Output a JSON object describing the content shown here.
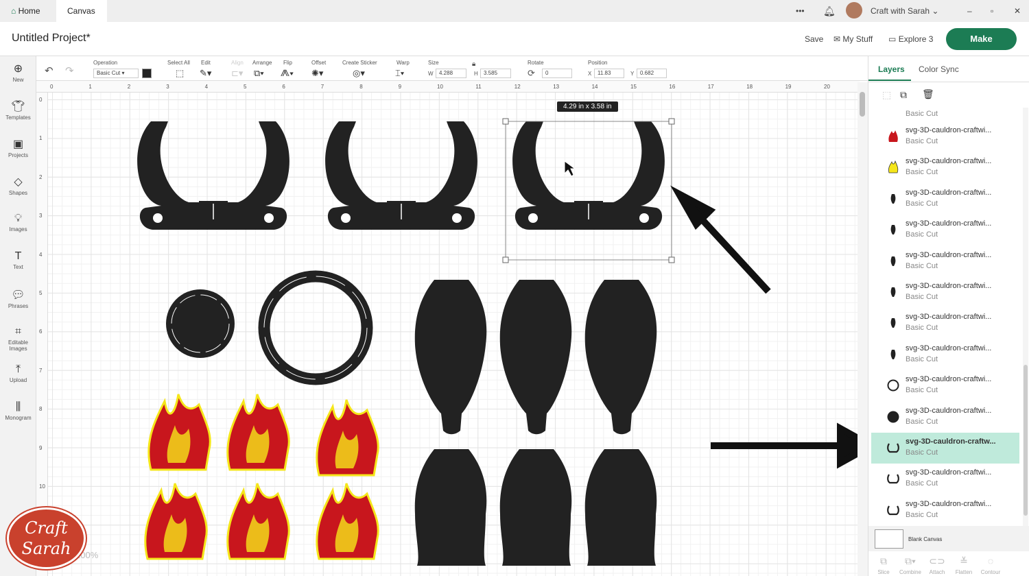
{
  "tabs": {
    "home": "Home",
    "canvas": "Canvas"
  },
  "topbar": {
    "more": "•••",
    "user": "Craft with Sarah"
  },
  "header": {
    "title": "Untitled Project*",
    "save": "Save",
    "my_stuff": "My Stuff",
    "machine": "Explore 3",
    "make": "Make"
  },
  "sidebar": [
    {
      "icon": "plus-icon",
      "label": "New"
    },
    {
      "icon": "shirt-icon",
      "label": "Templates"
    },
    {
      "icon": "projects-icon",
      "label": "Projects"
    },
    {
      "icon": "shapes-icon",
      "label": "Shapes"
    },
    {
      "icon": "bulb-icon",
      "label": "Images"
    },
    {
      "icon": "text-icon",
      "label": "Text"
    },
    {
      "icon": "chat-icon",
      "label": "Phrases"
    },
    {
      "icon": "editable-images-icon",
      "label": "Editable Images"
    },
    {
      "icon": "upload-icon",
      "label": "Upload"
    },
    {
      "icon": "monogram-icon",
      "label": "Monogram"
    }
  ],
  "toolbar": {
    "operation_label": "Operation",
    "operation_value": "Basic Cut",
    "select_all": "Select All",
    "edit": "Edit",
    "align": "Align",
    "arrange": "Arrange",
    "flip": "Flip",
    "offset": "Offset",
    "create_sticker": "Create Sticker",
    "warp": "Warp",
    "size": "Size",
    "w_label": "W",
    "w": "4.288",
    "h_label": "H",
    "h": "3.585",
    "rotate": "Rotate",
    "rotate_value": "0",
    "position": "Position",
    "x_label": "X",
    "x": "11.83",
    "y_label": "Y",
    "y": "0.682",
    "color": "#222222"
  },
  "ruler_h": [
    "0",
    "1",
    "2",
    "3",
    "4",
    "5",
    "6",
    "7",
    "8",
    "9",
    "10",
    "11",
    "12",
    "13",
    "14",
    "15",
    "16",
    "17",
    "18",
    "19",
    "20"
  ],
  "ruler_v": [
    "0",
    "1",
    "2",
    "3",
    "4",
    "5",
    "6",
    "7",
    "8",
    "9",
    "10"
  ],
  "selection_size": "4.29  in x 3.58  in",
  "zoom": "100%",
  "logo_text": "Craft with Sarah",
  "panel": {
    "tabs": [
      "Layers",
      "Color Sync"
    ],
    "layers": [
      {
        "name": "svg-3D-cauldron-craftwi...",
        "op": "Basic Cut",
        "thumb": "red-flame"
      },
      {
        "name": "svg-3D-cauldron-craftwi...",
        "op": "Basic Cut",
        "thumb": "yellow-flame"
      },
      {
        "name": "svg-3D-cauldron-craftwi...",
        "op": "Basic Cut",
        "thumb": "drop"
      },
      {
        "name": "svg-3D-cauldron-craftwi...",
        "op": "Basic Cut",
        "thumb": "drop"
      },
      {
        "name": "svg-3D-cauldron-craftwi...",
        "op": "Basic Cut",
        "thumb": "drop"
      },
      {
        "name": "svg-3D-cauldron-craftwi...",
        "op": "Basic Cut",
        "thumb": "drop"
      },
      {
        "name": "svg-3D-cauldron-craftwi...",
        "op": "Basic Cut",
        "thumb": "drop"
      },
      {
        "name": "svg-3D-cauldron-craftwi...",
        "op": "Basic Cut",
        "thumb": "drop"
      },
      {
        "name": "svg-3D-cauldron-craftwi...",
        "op": "Basic Cut",
        "thumb": "ring"
      },
      {
        "name": "svg-3D-cauldron-craftwi...",
        "op": "Basic Cut",
        "thumb": "circle"
      },
      {
        "name": "svg-3D-cauldron-craftw...",
        "op": "Basic Cut",
        "thumb": "cauldron",
        "selected": true
      },
      {
        "name": "svg-3D-cauldron-craftwi...",
        "op": "Basic Cut",
        "thumb": "cauldron"
      },
      {
        "name": "svg-3D-cauldron-craftwi...",
        "op": "Basic Cut",
        "thumb": "cauldron"
      }
    ],
    "partial_top": "Basic Cut",
    "blank_canvas": "Blank Canvas",
    "tools": [
      "Slice",
      "Combine",
      "Attach",
      "Flatten",
      "Contour"
    ]
  },
  "colors": {
    "accent": "#1c7c54",
    "selected": "#bfeadb",
    "flame_red": "#c8161d",
    "flame_yellow": "#f5e61a",
    "shape": "#222222"
  }
}
